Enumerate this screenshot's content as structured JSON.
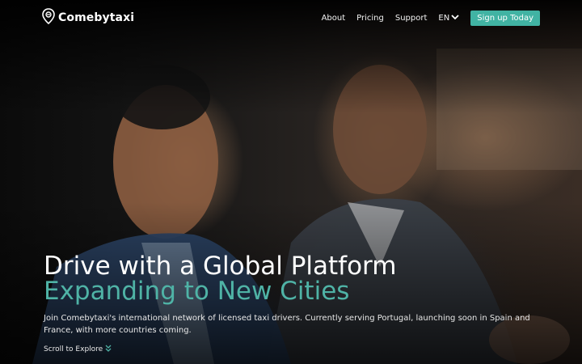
{
  "brand": {
    "name": "Comebytaxi"
  },
  "nav": {
    "links": [
      "About",
      "Pricing",
      "Support"
    ],
    "language": "EN",
    "cta": "Sign up Today"
  },
  "hero": {
    "headline_line1": "Drive with a Global Platform",
    "headline_line2": "Expanding to New Cities",
    "description": "Join Comebytaxi's international network of licensed taxi drivers. Currently serving Portugal, launching soon in Spain and France, with more countries coming.",
    "scroll_label": "Scroll to Explore"
  },
  "colors": {
    "accent": "#41b3a3",
    "background": "#0b0b0b"
  },
  "icons": [
    "location-pin-icon",
    "chevron-down-icon",
    "double-chevron-down-icon"
  ]
}
